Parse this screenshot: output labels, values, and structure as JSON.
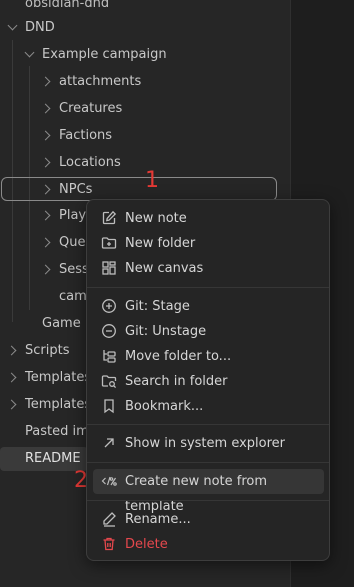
{
  "tree": {
    "vault_name": "obsidian-dnd",
    "items": [
      {
        "label": "DND"
      },
      {
        "label": "Example campaign"
      },
      {
        "label": "attachments"
      },
      {
        "label": "Creatures"
      },
      {
        "label": "Factions"
      },
      {
        "label": "Locations"
      },
      {
        "label": "NPCs"
      },
      {
        "label": "Play"
      },
      {
        "label": "Que"
      },
      {
        "label": "Sess"
      },
      {
        "label": "cam"
      },
      {
        "label": "Game l"
      },
      {
        "label": "Scripts"
      },
      {
        "label": "Templates"
      },
      {
        "label": "Templates"
      },
      {
        "label": "Pasted im"
      },
      {
        "label": "README"
      }
    ]
  },
  "annotations": {
    "step1": "1",
    "step2": "2"
  },
  "context_menu": {
    "items": [
      {
        "label": "New note",
        "icon": "edit-icon"
      },
      {
        "label": "New folder",
        "icon": "folder-plus-icon"
      },
      {
        "label": "New canvas",
        "icon": "canvas-icon"
      },
      {
        "label": "Git: Stage",
        "icon": "plus-circle-icon"
      },
      {
        "label": "Git: Unstage",
        "icon": "minus-circle-icon"
      },
      {
        "label": "Move folder to...",
        "icon": "folder-tree-icon"
      },
      {
        "label": "Search in folder",
        "icon": "folder-search-icon"
      },
      {
        "label": "Bookmark...",
        "icon": "bookmark-icon"
      },
      {
        "label": "Show in system explorer",
        "icon": "arrow-up-right-icon"
      },
      {
        "label": "Create new note from template",
        "icon": "template-icon"
      },
      {
        "label": "Rename...",
        "icon": "pencil-icon"
      },
      {
        "label": "Delete",
        "icon": "trash-icon"
      }
    ]
  },
  "colors": {
    "accent_red": "#e53935",
    "danger": "#e5484d"
  }
}
